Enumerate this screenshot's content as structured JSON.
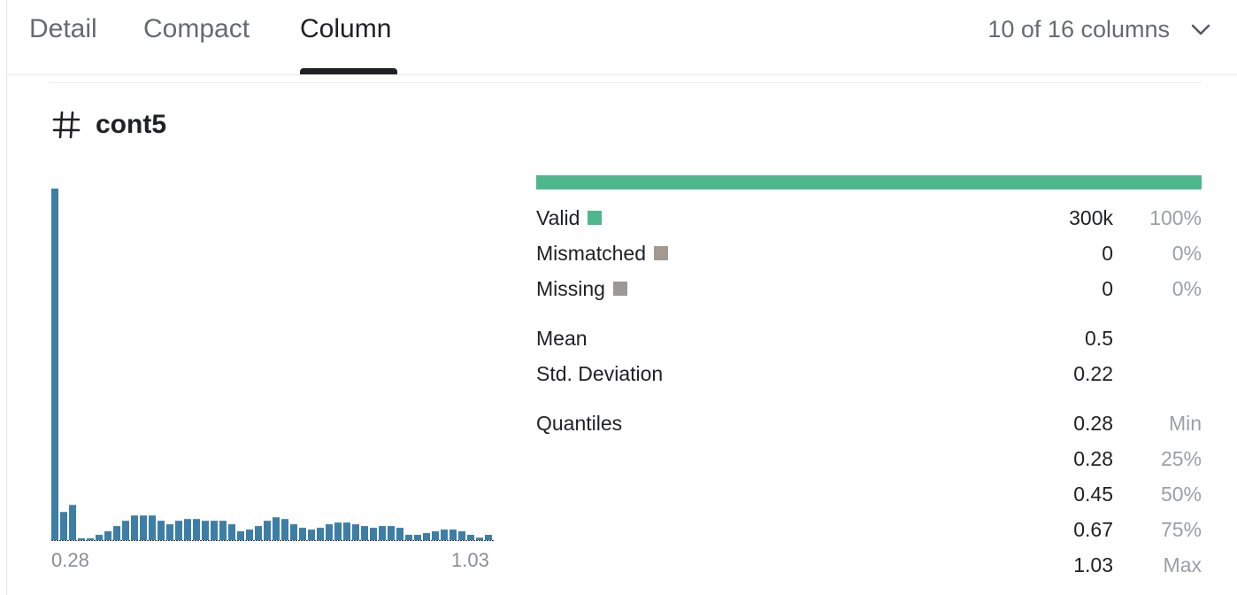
{
  "tabs": [
    {
      "label": "Detail",
      "active": false
    },
    {
      "label": "Compact",
      "active": false
    },
    {
      "label": "Column",
      "active": true
    }
  ],
  "column_selector": {
    "label": "10 of 16 columns",
    "icon": "chevron-down-icon"
  },
  "column": {
    "icon": "hash-icon",
    "name": "cont5"
  },
  "chart_data": {
    "type": "bar",
    "title": "",
    "xlabel": "",
    "ylabel": "",
    "x_min": 0.28,
    "x_max": 1.03,
    "x_tick_labels": [
      "0.28",
      "1.03"
    ],
    "color": "#3d7ea6",
    "values": [
      100,
      8,
      10,
      0.5,
      0.5,
      1.5,
      2.5,
      4,
      5.5,
      7,
      7,
      7,
      5.5,
      4.5,
      5.5,
      6,
      6,
      5.5,
      5.5,
      5.5,
      4.5,
      2.5,
      3,
      4,
      5.5,
      6.5,
      6,
      4.5,
      3.5,
      3,
      3.5,
      4.5,
      5,
      5,
      4.5,
      4,
      3.5,
      4,
      4,
      3.5,
      1.5,
      1.5,
      2,
      2.5,
      3,
      3,
      2.5,
      1.5,
      0.7,
      1.5
    ]
  },
  "stats": {
    "valid_bar_color": "#4db88c",
    "status": [
      {
        "label": "Valid",
        "value": "300k",
        "pct": "100%",
        "color": "#4db88c"
      },
      {
        "label": "Mismatched",
        "value": "0",
        "pct": "0%",
        "color": "#a39990"
      },
      {
        "label": "Missing",
        "value": "0",
        "pct": "0%",
        "color": "#9c9896"
      }
    ],
    "mean": {
      "label": "Mean",
      "value": "0.5"
    },
    "std": {
      "label": "Std. Deviation",
      "value": "0.22"
    },
    "quantiles_label": "Quantiles",
    "quantiles": [
      {
        "value": "0.28",
        "name": "Min"
      },
      {
        "value": "0.28",
        "name": "25%"
      },
      {
        "value": "0.45",
        "name": "50%"
      },
      {
        "value": "0.67",
        "name": "75%"
      },
      {
        "value": "1.03",
        "name": "Max"
      }
    ]
  }
}
